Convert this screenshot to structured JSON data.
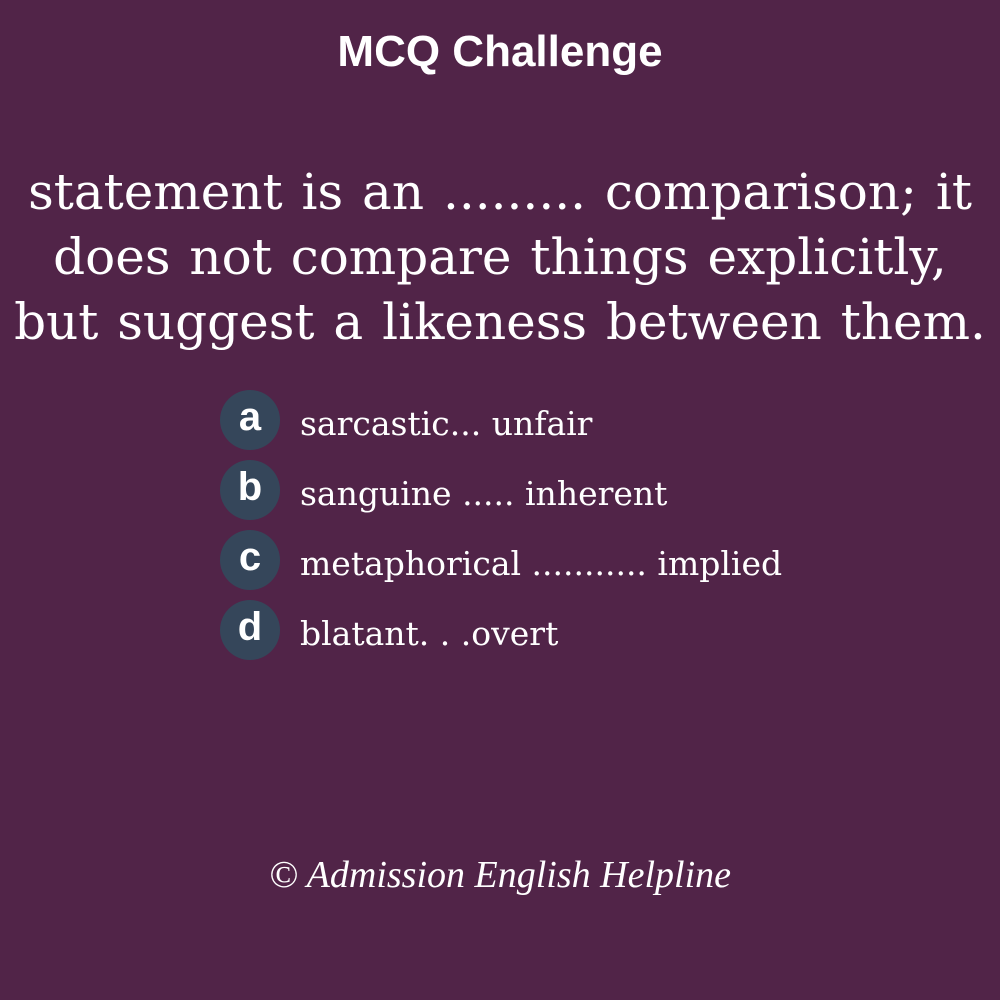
{
  "title": "MCQ Challenge",
  "question": "statement is an ......... comparison; it does not compare things explicitly, but suggest a likeness between them.",
  "options": [
    {
      "letter": "a",
      "text": "sarcastic... unfair"
    },
    {
      "letter": "b",
      "text": "sanguine ..... inherent"
    },
    {
      "letter": "c",
      "text": "metaphorical ........... implied"
    },
    {
      "letter": "d",
      "text": "blatant. . .overt"
    }
  ],
  "footer": "© Admission English Helpline",
  "colors": {
    "background": "#512448",
    "badge": "#35465a",
    "text": "#ffffff"
  }
}
